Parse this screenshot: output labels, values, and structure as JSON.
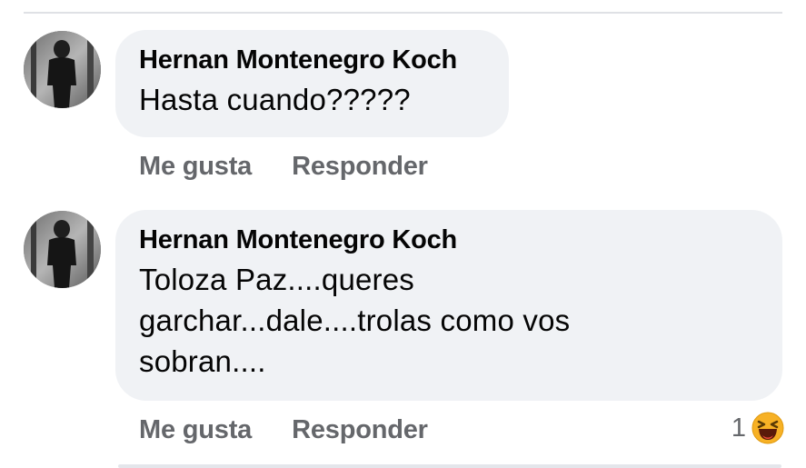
{
  "comments": [
    {
      "author": "Hernan Montenegro Koch",
      "text": "Hasta cuando?????",
      "like_label": "Me gusta",
      "reply_label": "Responder",
      "avatar_icon": "profile-photo-icon"
    },
    {
      "author": "Hernan Montenegro Koch",
      "text_lines": [
        "Toloza Paz....queres",
        "garchar...dale....trolas como vos",
        "sobran...."
      ],
      "like_label": "Me gusta",
      "reply_label": "Responder",
      "reaction_count": "1",
      "reaction_icon": "haha-emoji-icon",
      "avatar_icon": "profile-photo-icon"
    }
  ],
  "colors": {
    "bubble_bg": "#f0f2f5",
    "text": "#050505",
    "secondary_text": "#65676b",
    "haha_yellow": "#f7b125"
  }
}
